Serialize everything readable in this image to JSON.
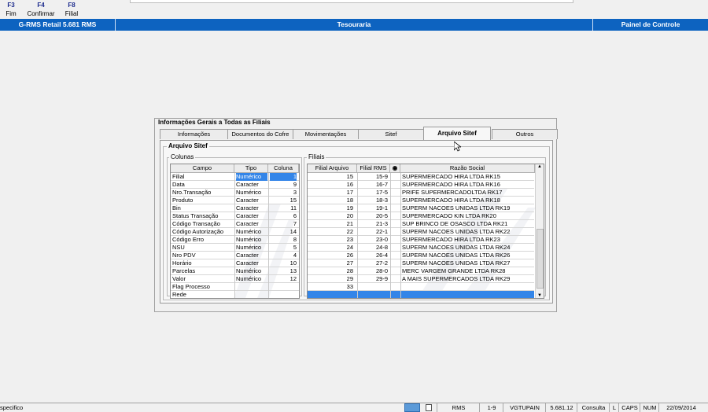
{
  "fkeys": [
    {
      "key": "F3",
      "label": "Fim"
    },
    {
      "key": "F4",
      "label": "Confirmar"
    },
    {
      "key": "F8",
      "label": "Filial"
    }
  ],
  "titlebar": {
    "app": "G-RMS Retail 5.681 RMS",
    "module": "Tesouraria",
    "right": "Painel de Controle"
  },
  "panel": {
    "title": "Informações Gerais a Todas as Filiais",
    "tabs": [
      "Informações",
      "Documentos do Cofre",
      "Movimentações",
      "Sitef",
      "Arquivo  Sitef",
      "Outros"
    ],
    "active_tab": 4
  },
  "arquivo": {
    "group_title": "Arquivo Sitef",
    "colunas": {
      "title": "Colunas",
      "headers": [
        "Campo",
        "Tipo",
        "Coluna"
      ],
      "rows": [
        [
          "Filial",
          "Numérico",
          "1"
        ],
        [
          "Data",
          "Caracter",
          "9"
        ],
        [
          "Nro.Transação",
          "Numérico",
          "3"
        ],
        [
          "Produto",
          "Caracter",
          "15"
        ],
        [
          "Bin",
          "Caracter",
          "11"
        ],
        [
          "Status Transação",
          "Caracter",
          "6"
        ],
        [
          "Código Transação",
          "Caracter",
          "7"
        ],
        [
          "Código Autorização",
          "Numérico",
          "14"
        ],
        [
          "Código Erro",
          "Numérico",
          "8"
        ],
        [
          "NSU",
          "Numérico",
          "5"
        ],
        [
          "Nro PDV",
          "Caracter",
          "4"
        ],
        [
          "Horário",
          "Caracter",
          "10"
        ],
        [
          "Parcelas",
          "Numérico",
          "13"
        ],
        [
          "Valor",
          "Numérico",
          "12"
        ],
        [
          "Flag Processo",
          "",
          ""
        ],
        [
          "Rede",
          "",
          ""
        ]
      ]
    },
    "filiais": {
      "title": "Filiais",
      "headers": [
        "Filial Arquivo",
        "Filial RMS",
        "",
        "Razão Social"
      ],
      "rows": [
        [
          "15",
          "15-9",
          "SUPERMERCADO HIRA LTDA RK15"
        ],
        [
          "16",
          "16-7",
          "SUPERMERCADO HIRA LTDA RK16"
        ],
        [
          "17",
          "17-5",
          "PRIFE SUPERMERCADOLTDA RK17"
        ],
        [
          "18",
          "18-3",
          "SUPERMERCADO HIRA LTDA RK18"
        ],
        [
          "19",
          "19-1",
          "SUPERM NACOES UNIDAS LTDA RK19"
        ],
        [
          "20",
          "20-5",
          "SUPERMERCADO KIN LTDA RK20"
        ],
        [
          "21",
          "21-3",
          "SUP BRINCO DE OSASCO LTDA RK21"
        ],
        [
          "22",
          "22-1",
          "SUPERM NACOES UNIDAS LTDA RK22"
        ],
        [
          "23",
          "23-0",
          "SUPERMERCADO HIRA LTDA RK23"
        ],
        [
          "24",
          "24-8",
          "SUPERM NACOES UNIDAS LTDA RK24"
        ],
        [
          "26",
          "26-4",
          "SUPERM NACOES UNIDAS LTDA RK26"
        ],
        [
          "27",
          "27-2",
          "SUPERM NACOES UNIDAS LTDA RK27"
        ],
        [
          "28",
          "28-0",
          "MERC VARGEM GRANDE LTDA RK28"
        ],
        [
          "29",
          "29-9",
          "A MAIS SUPERMERCADOS LTDA RK29"
        ],
        [
          "33",
          "",
          ""
        ],
        [
          "",
          "",
          ""
        ]
      ]
    }
  },
  "statusbar": {
    "left": "specifico",
    "cells": [
      "RMS",
      "1-9",
      "VGTUPAIN",
      "5.681.12",
      "Consulta",
      "L",
      "CAPS",
      "NUM",
      "22/09/2014"
    ]
  }
}
